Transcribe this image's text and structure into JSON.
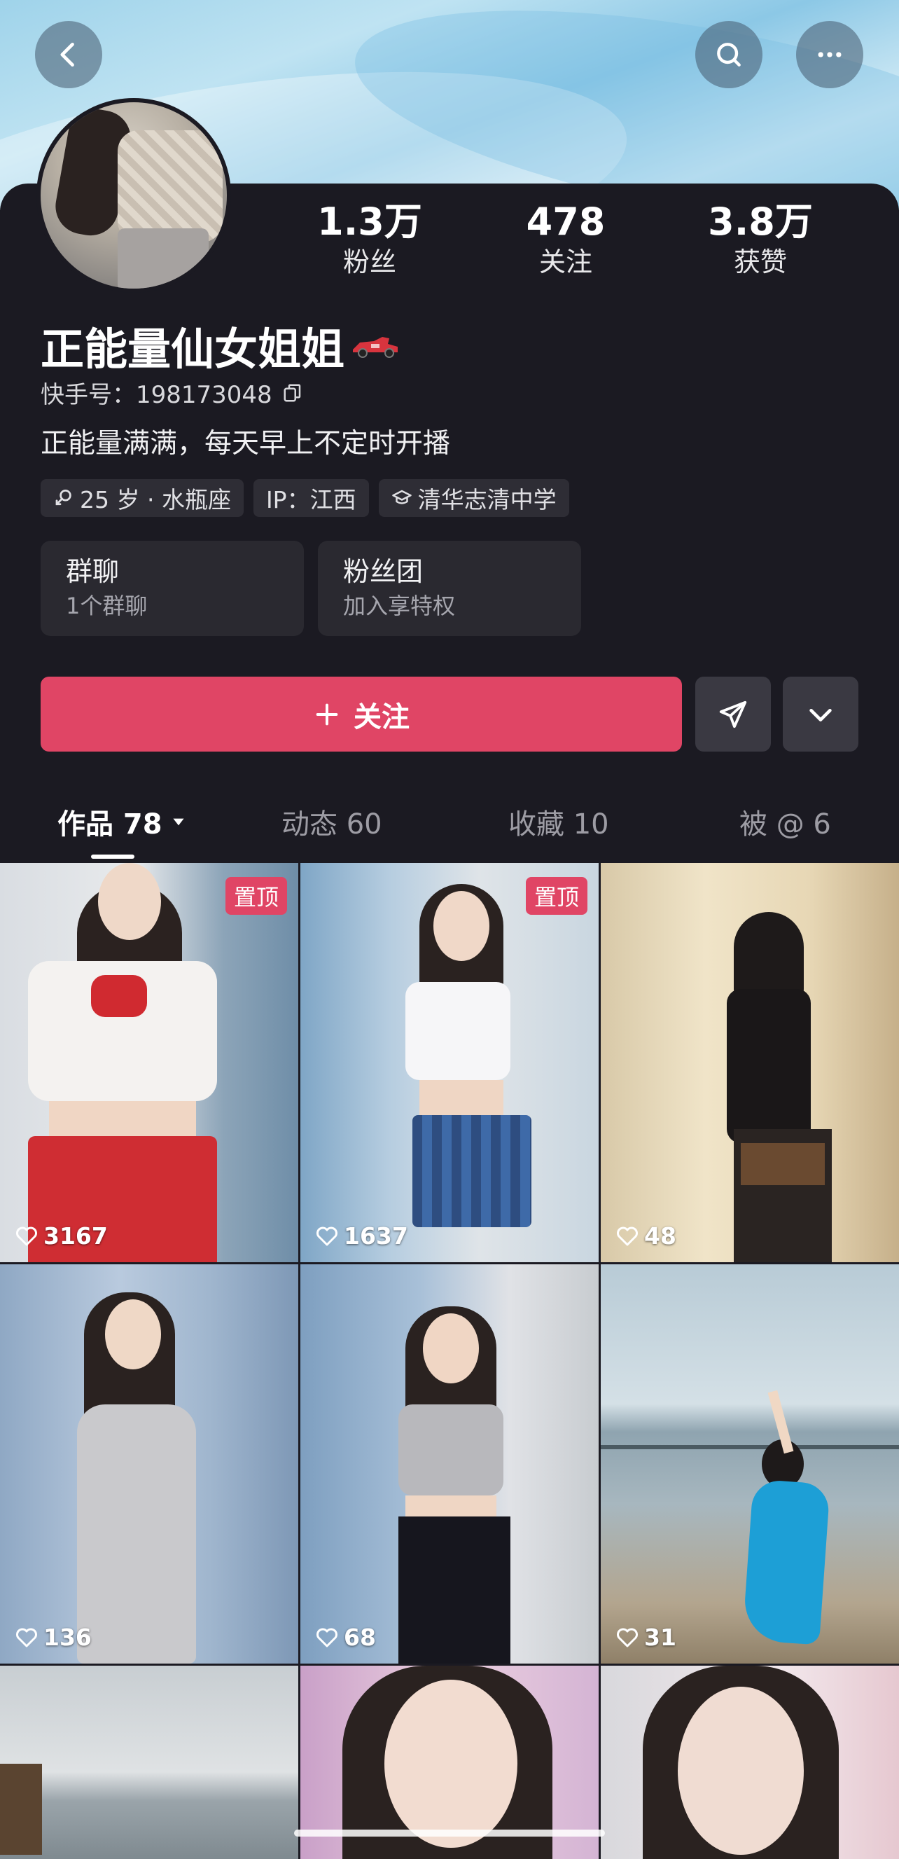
{
  "header": {
    "back_icon": "chevron-left-icon",
    "search_icon": "search-icon",
    "more_icon": "ellipsis-icon"
  },
  "profile": {
    "name": "正能量仙女姐姐",
    "name_emoji": "race-car-emoji",
    "kuaishou_id": "快手号：198173048",
    "bio": "正能量满满，每天早上不定时开播",
    "stats": [
      {
        "value": "1.3万",
        "label": "粉丝"
      },
      {
        "value": "478",
        "label": "关注"
      },
      {
        "value": "3.8万",
        "label": "获赞"
      }
    ],
    "tags": [
      {
        "icon": "gender-female-icon",
        "label": "25 岁 · 水瓶座"
      },
      {
        "label": "IP：江西"
      },
      {
        "icon": "graduation-cap-icon",
        "label": "清华志清中学"
      }
    ],
    "cards": [
      {
        "title": "群聊",
        "subtitle": "1个群聊"
      },
      {
        "title": "粉丝团",
        "subtitle": "加入享特权"
      }
    ]
  },
  "actions": {
    "follow_label": "关注",
    "share_icon": "paper-plane-icon",
    "expand_icon": "chevron-down-icon"
  },
  "tabs": [
    {
      "label": "作品 78",
      "active": true
    },
    {
      "label": "动态 60"
    },
    {
      "label": "收藏 10"
    },
    {
      "label": "被 @ 6"
    }
  ],
  "posts": [
    {
      "likes": "3167",
      "pinned": "置顶"
    },
    {
      "likes": "1637",
      "pinned": "置顶"
    },
    {
      "likes": "48"
    },
    {
      "likes": "136"
    },
    {
      "likes": "68"
    },
    {
      "likes": "31"
    },
    {},
    {},
    {}
  ],
  "colors": {
    "accent": "#e04565",
    "background": "#1b1a22"
  }
}
